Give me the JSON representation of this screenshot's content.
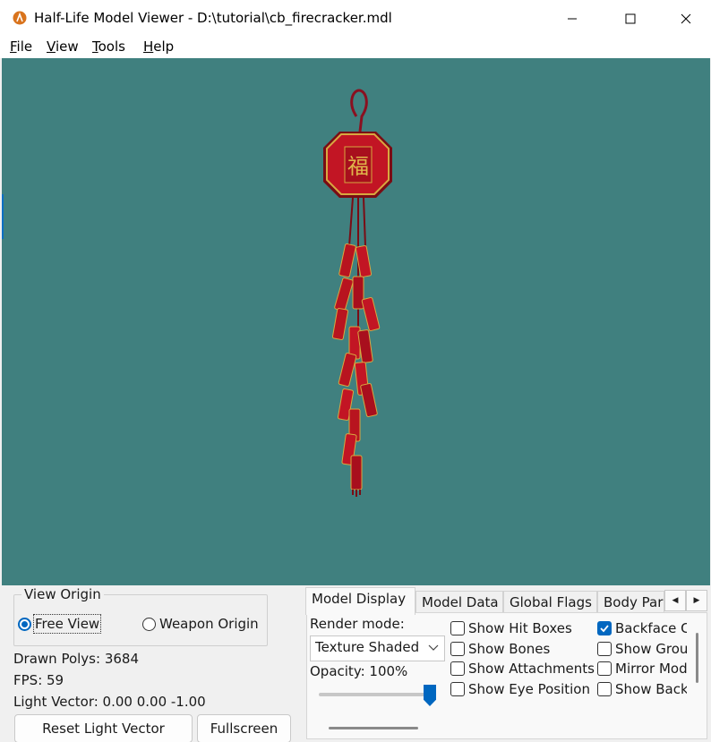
{
  "window": {
    "title": "Half-Life Model Viewer - D:\\tutorial\\cb_firecracker.mdl",
    "app_icon": "half-life-lambda-icon"
  },
  "menu": [
    {
      "accel": "F",
      "rest": "ile"
    },
    {
      "accel": "V",
      "rest": "iew"
    },
    {
      "accel": "T",
      "rest": "ools"
    },
    {
      "accel": "H",
      "rest": "elp"
    }
  ],
  "viewport": {
    "background": "#40807f",
    "model": "firecracker-string-ornament",
    "ornament_glyph": "福"
  },
  "view_origin": {
    "title": "View Origin",
    "options": [
      "Free View",
      "Weapon Origin"
    ],
    "selected": "Free View"
  },
  "stats": {
    "drawn_polys": "Drawn Polys: 3684",
    "fps": "FPS: 59",
    "light_vector": "Light Vector: 0.00 0.00 -1.00"
  },
  "buttons": {
    "reset_light": "Reset Light Vector",
    "fullscreen": "Fullscreen"
  },
  "tabs": [
    "Model Display",
    "Model Data",
    "Global Flags",
    "Body Par"
  ],
  "active_tab": "Model Display",
  "model_display": {
    "render_mode_label": "Render mode:",
    "render_mode_value": "Texture Shaded",
    "opacity_label": "Opacity: 100%",
    "opacity": 1.0,
    "checks_col1": [
      {
        "label": "Show Hit Boxes",
        "checked": false
      },
      {
        "label": "Show Bones",
        "checked": false
      },
      {
        "label": "Show Attachments",
        "checked": false
      },
      {
        "label": "Show Eye Position",
        "checked": false
      }
    ],
    "checks_col2": [
      {
        "label": "Backface Culling",
        "checked": true
      },
      {
        "label": "Show Ground",
        "checked": false
      },
      {
        "label": "Mirror Model",
        "checked": false
      },
      {
        "label": "Show Background",
        "checked": false
      }
    ]
  },
  "colors": {
    "accent": "#0067c0",
    "viewport_bg": "#40807f"
  }
}
